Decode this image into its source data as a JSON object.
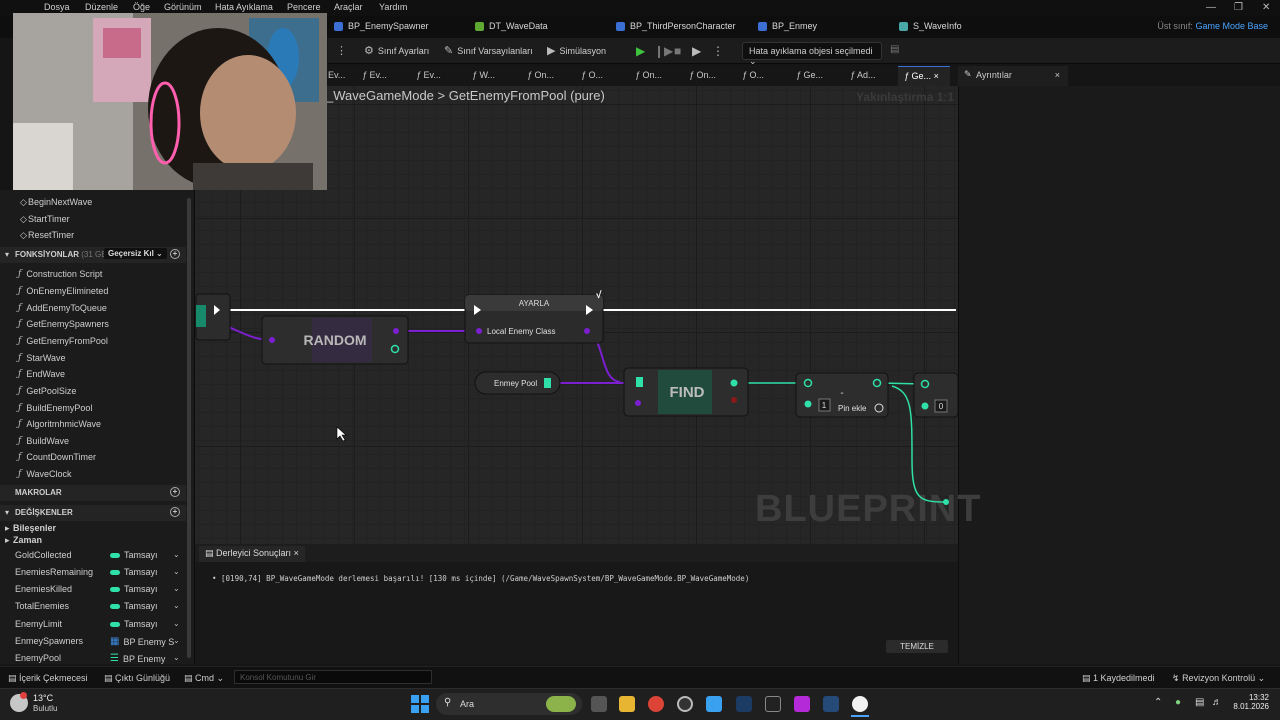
{
  "menu": [
    "Dosya",
    "Düzenle",
    "Öğe",
    "Görünüm",
    "Hata Ayıklama",
    "Pencere",
    "Araçlar",
    "Yardım"
  ],
  "tabs": [
    "BP_EnemySpawner",
    "DT_WaveData",
    "BP_ThirdPersonCharacter",
    "BP_Enmey",
    "S_WaveInfo"
  ],
  "parent_class": {
    "label": "Üst sınıf:",
    "value": "Game Mode Base"
  },
  "toolbar": {
    "class_settings": "Sınıf Ayarları",
    "class_defaults": "Sınıf Varsayılanları",
    "simulation": "Simülasyon",
    "debug_select": "Hata ayıklama objesi seçilmedi"
  },
  "function_tabs": [
    "Ev...",
    "Ev...",
    "W...",
    "On...",
    "O...",
    "On...",
    "On...",
    "O...",
    "Ge...",
    "Ad...",
    "Ge..."
  ],
  "details": {
    "title": "Ayrıntılar"
  },
  "breadcrumb": {
    "parent": "_WaveGameMode",
    "sep": ">",
    "current": "GetEnemyFromPool (pure)"
  },
  "zoom": "Yakınlaştırma 1:1",
  "events": [
    "BeginNextWave",
    "StartTimer",
    "ResetTimer"
  ],
  "functions_section": {
    "label": "FONKSİYONLAR",
    "count": "(31 GEÇ",
    "override": "Geçersiz Kıl"
  },
  "functions": [
    "Construction Script",
    "OnEnemyElimineted",
    "AddEnemyToQueue",
    "GetEnemySpawners",
    "GetEnemyFromPool",
    "StarWave",
    "EndWave",
    "GetPoolSize",
    "BuildEnemyPool",
    "AlgoritmhmicWave",
    "BuildWave",
    "CountDownTimer",
    "WaveClock"
  ],
  "macros_section": "MAKROLAR",
  "variables_section": "DEĞİŞKENLER",
  "categories": [
    "Bileşenler",
    "Zaman"
  ],
  "variables": [
    {
      "name": "GoldCollected",
      "type": "Tamsayı"
    },
    {
      "name": "EnemiesRemaining",
      "type": "Tamsayı"
    },
    {
      "name": "EnemiesKilled",
      "type": "Tamsayı"
    },
    {
      "name": "TotalEnemies",
      "type": "Tamsayı"
    },
    {
      "name": "EnemyLimit",
      "type": "Tamsayı"
    },
    {
      "name": "EnmeySpawners",
      "type": "BP Enemy S"
    },
    {
      "name": "EnemyPool",
      "type": "BP Enemy"
    }
  ],
  "nodes": {
    "random": "RANDOM",
    "set_title": "AYARLA",
    "set_var": "Local Enemy Class",
    "pool_var": "Enmey Pool",
    "find": "FIND",
    "subtract": "-",
    "add_pin": "Pin ekle",
    "literal_one": "1",
    "literal_zero": "0"
  },
  "watermark": "BLUEPRINT",
  "output": {
    "tab": "Derleyici Sonuçları",
    "log": "[0190,74] BP_WaveGameMode derlemesi başarılı! [130 ms içinde] (/Game/WaveSpawnSystem/BP_WaveGameMode.BP_WaveGameMode)",
    "clear": "TEMİZLE"
  },
  "statusbar": {
    "content_drawer": "İçerik Çekmecesi",
    "output_log": "Çıktı Günlüğü",
    "cmd": "Cmd",
    "console_placeholder": "Konsol Komutunu Gir",
    "saved": "1 Kaydedilmedi",
    "revision": "Revizyon Kontrolü"
  },
  "taskbar": {
    "temp": "13°C",
    "weather": "Bulutlu",
    "search": "Ara",
    "time": "13:32",
    "date": "8.01.2026"
  },
  "colors": {
    "accent": "#3a6fd8",
    "exec": "#ffffff",
    "object_pin": "#7b1fd0",
    "int_pin": "#2fe0a8",
    "parent": "#4aa3ff"
  }
}
